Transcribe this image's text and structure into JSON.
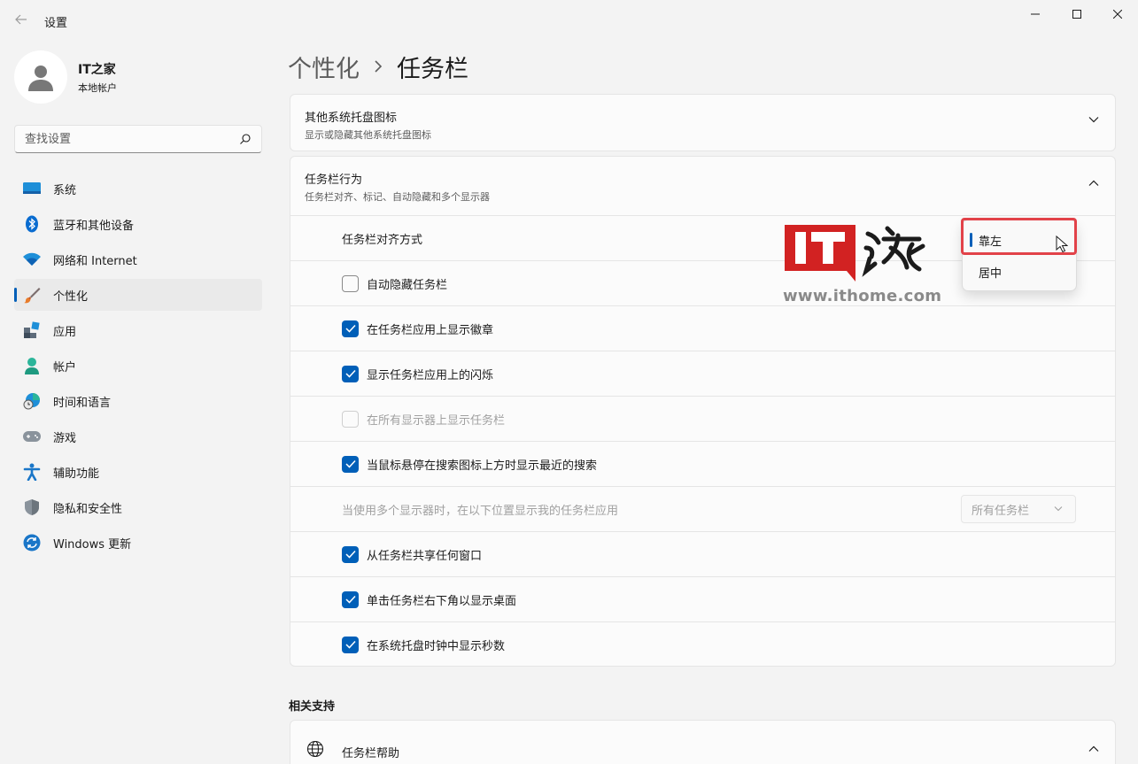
{
  "window": {
    "title": "设置"
  },
  "profile": {
    "name": "IT之家",
    "account_type": "本地帐户"
  },
  "search": {
    "placeholder": "查找设置"
  },
  "sidebar": {
    "items": [
      {
        "label": "系统",
        "icon": "system-icon"
      },
      {
        "label": "蓝牙和其他设备",
        "icon": "bluetooth-icon"
      },
      {
        "label": "网络和 Internet",
        "icon": "wifi-icon"
      },
      {
        "label": "个性化",
        "icon": "brush-icon",
        "active": true
      },
      {
        "label": "应用",
        "icon": "apps-icon"
      },
      {
        "label": "帐户",
        "icon": "account-icon"
      },
      {
        "label": "时间和语言",
        "icon": "globe-clock-icon"
      },
      {
        "label": "游戏",
        "icon": "gamepad-icon"
      },
      {
        "label": "辅助功能",
        "icon": "accessibility-icon"
      },
      {
        "label": "隐私和安全性",
        "icon": "shield-icon"
      },
      {
        "label": "Windows 更新",
        "icon": "update-icon"
      }
    ]
  },
  "breadcrumb": {
    "parent": "个性化",
    "current": "任务栏"
  },
  "tray_card": {
    "title": "其他系统托盘图标",
    "subtitle": "显示或隐藏其他系统托盘图标"
  },
  "behavior_card": {
    "title": "任务栏行为",
    "subtitle": "任务栏对齐、标记、自动隐藏和多个显示器",
    "alignment_label": "任务栏对齐方式",
    "alignment_options": [
      "靠左",
      "居中"
    ],
    "alignment_selected": "靠左",
    "options": [
      {
        "label": "自动隐藏任务栏",
        "checked": false,
        "enabled": true
      },
      {
        "label": "在任务栏应用上显示徽章",
        "checked": true,
        "enabled": true
      },
      {
        "label": "显示任务栏应用上的闪烁",
        "checked": true,
        "enabled": true
      },
      {
        "label": "在所有显示器上显示任务栏",
        "checked": false,
        "enabled": false
      },
      {
        "label": "当鼠标悬停在搜索图标上方时显示最近的搜索",
        "checked": true,
        "enabled": true
      }
    ],
    "multi_display_label": "当使用多个显示器时，在以下位置显示我的任务栏应用",
    "multi_display_value": "所有任务栏",
    "options2": [
      {
        "label": "从任务栏共享任何窗口",
        "checked": true,
        "enabled": true
      },
      {
        "label": "单击任务栏右下角以显示桌面",
        "checked": true,
        "enabled": true
      },
      {
        "label": "在系统托盘时钟中显示秒数",
        "checked": true,
        "enabled": true
      }
    ]
  },
  "related": {
    "title": "相关支持",
    "help_label": "任务栏帮助"
  },
  "watermark": {
    "text": "www.ithome.com"
  },
  "colors": {
    "accent": "#005fb8",
    "highlight": "#e24249",
    "watermark_red": "#d22222"
  }
}
